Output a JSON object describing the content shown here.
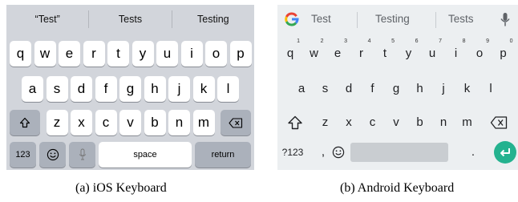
{
  "ios": {
    "suggestions": [
      "“Test”",
      "Tests",
      "Testing"
    ],
    "row1": [
      "q",
      "w",
      "e",
      "r",
      "t",
      "y",
      "u",
      "i",
      "o",
      "p"
    ],
    "row2": [
      "a",
      "s",
      "d",
      "f",
      "g",
      "h",
      "j",
      "k",
      "l"
    ],
    "row3": [
      "z",
      "x",
      "c",
      "v",
      "b",
      "n",
      "m"
    ],
    "numbers_label": "123",
    "space_label": "space",
    "return_label": "return",
    "shift_icon": "shift-icon",
    "backspace_icon": "backspace-icon",
    "emoji_icon": "emoji-icon",
    "mic_icon": "microphone-icon",
    "colors": {
      "background": "#d2d5db",
      "key": "#ffffff",
      "function_key": "#abb1bb"
    }
  },
  "android": {
    "suggestions": [
      "Test",
      "Testing",
      "Tests"
    ],
    "row1": [
      "q",
      "w",
      "e",
      "r",
      "t",
      "y",
      "u",
      "i",
      "o",
      "p"
    ],
    "row1_numbers": [
      "1",
      "2",
      "3",
      "4",
      "5",
      "6",
      "7",
      "8",
      "9",
      "0"
    ],
    "row2": [
      "a",
      "s",
      "d",
      "f",
      "g",
      "h",
      "j",
      "k",
      "l"
    ],
    "row3": [
      "z",
      "x",
      "c",
      "v",
      "b",
      "n",
      "m"
    ],
    "symbols_label": "?123",
    "comma_label": ",",
    "period_label": ".",
    "google_icon": "google-g-icon",
    "mic_icon": "microphone-icon",
    "shift_icon": "shift-icon",
    "backspace_icon": "backspace-icon",
    "emoji_icon": "emoji-icon",
    "enter_icon": "enter-icon",
    "colors": {
      "background": "#eceff1",
      "space_bar": "#c9cdd1",
      "enter": "#24b28f"
    }
  },
  "captions": {
    "ios": "(a) iOS Keyboard",
    "android": "(b) Android Keyboard"
  }
}
